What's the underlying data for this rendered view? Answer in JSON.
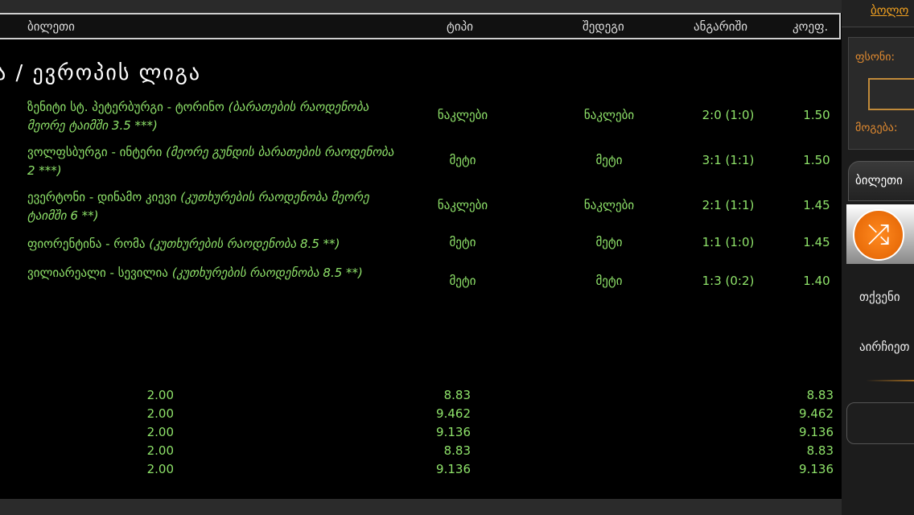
{
  "header": {
    "ticket": "ბილეთი",
    "type": "ტიპი",
    "result": "შედეგი",
    "score": "ანგარიში",
    "odds": "კოეფ."
  },
  "league": "ა / ევროპის ლიგა",
  "rows": [
    {
      "event": "ზენიტი სტ. პეტერბურგი - ტორინო",
      "market": "(ბარათების რაოდენობა მეორე ტაიმში 3.5 ***)",
      "type": "ნაკლები",
      "result": "ნაკლები",
      "score": "2:0 (1:0)",
      "odds": "1.50"
    },
    {
      "event": "ვოლფსბურგი - ინტერი",
      "market": "(მეორე გუნდის ბარათების რაოდენობა 2 ***)",
      "type": "მეტი",
      "result": "მეტი",
      "score": "3:1 (1:1)",
      "odds": "1.50"
    },
    {
      "event": "ევერტონი - დინამო კიევი",
      "market": "(კუთხურების რაოდენობა მეორე ტაიმში 6 **)",
      "type": "ნაკლები",
      "result": "ნაკლები",
      "score": "2:1 (1:1)",
      "odds": "1.45"
    },
    {
      "event": "ფიორენტინა - რომა",
      "market": "(კუთხურების რაოდენობა 8.5 **)",
      "type": "მეტი",
      "result": "მეტი",
      "score": "1:1 (1:0)",
      "odds": "1.45"
    },
    {
      "event": "ვილიარეალი - სევილია",
      "market": "(კუთხურების რაოდენობა 8.5 **)",
      "type": "მეტი",
      "result": "მეტი",
      "score": "1:3 (0:2)",
      "odds": "1.40"
    }
  ],
  "summary": [
    {
      "stake": "2.00",
      "total": "8.83",
      "win": "8.83"
    },
    {
      "stake": "2.00",
      "total": "9.462",
      "win": "9.462"
    },
    {
      "stake": "2.00",
      "total": "9.136",
      "win": "9.136"
    },
    {
      "stake": "2.00",
      "total": "8.83",
      "win": "8.83"
    },
    {
      "stake": "2.00",
      "total": "9.136",
      "win": "9.136"
    }
  ],
  "side": {
    "last": "ბოლო",
    "stake": "ფსონი:",
    "win": "მოგება:",
    "tickets": "ბილეთი",
    "yours": "თქვენი",
    "choose": "აირჩიეთ"
  }
}
